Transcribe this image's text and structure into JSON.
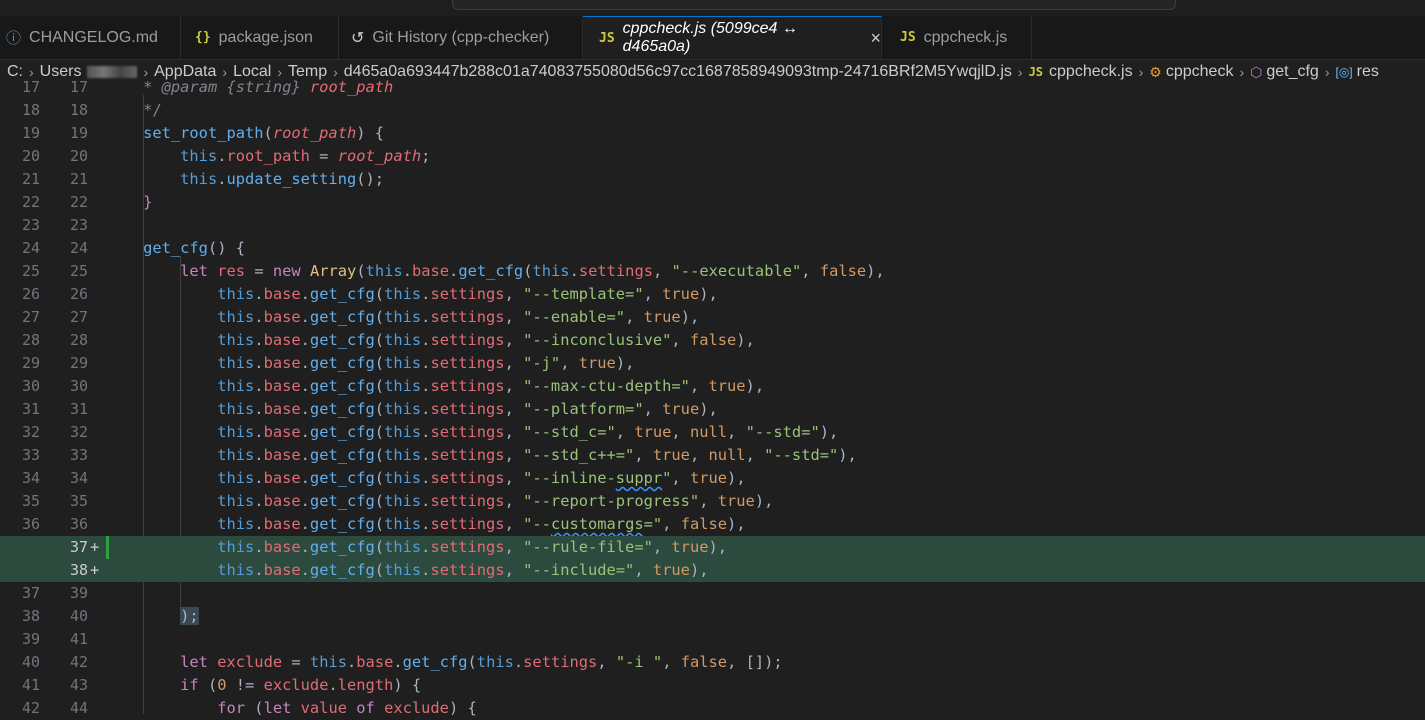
{
  "window": {
    "title_fragment": "cpp-checker"
  },
  "tabs": [
    {
      "label": "CHANGELOG.md",
      "icon": "info-circle-icon",
      "active": false
    },
    {
      "label": "package.json",
      "icon": "json-braces-icon",
      "active": false
    },
    {
      "label": "Git History (cpp-checker)",
      "icon": "history-icon",
      "active": false
    },
    {
      "label": "cppcheck.js (5099ce4 ↔ d465a0a)",
      "icon": "js-file-icon",
      "active": true,
      "close": "×"
    },
    {
      "label": "cppcheck.js",
      "icon": "js-file-icon",
      "active": false
    }
  ],
  "breadcrumb": {
    "drive": "C:",
    "users": "Users",
    "appdata": "AppData",
    "local": "Local",
    "temp": "Temp",
    "file": "d465a0a693447b288c01a74083755080d56c97cc1687858949093tmp-24716BRf2M5YwqjlD.js",
    "js_label": "JS",
    "js_file": "cppcheck.js",
    "class": "cppcheck",
    "method": "get_cfg",
    "variable": "res"
  },
  "colors": {
    "accent": "#0078d4",
    "added_line_bg": "#2d4a3e",
    "added_bar": "#2ea043",
    "js_icon": "#cbcb41"
  },
  "lines": [
    {
      "ln1": "17",
      "ln2": "17"
    },
    {
      "ln1": "18",
      "ln2": "18"
    },
    {
      "ln1": "19",
      "ln2": "19"
    },
    {
      "ln1": "20",
      "ln2": "20"
    },
    {
      "ln1": "21",
      "ln2": "21"
    },
    {
      "ln1": "22",
      "ln2": "22"
    },
    {
      "ln1": "23",
      "ln2": "23"
    },
    {
      "ln1": "24",
      "ln2": "24"
    },
    {
      "ln1": "25",
      "ln2": "25"
    },
    {
      "ln1": "26",
      "ln2": "26"
    },
    {
      "ln1": "27",
      "ln2": "27"
    },
    {
      "ln1": "28",
      "ln2": "28"
    },
    {
      "ln1": "29",
      "ln2": "29"
    },
    {
      "ln1": "30",
      "ln2": "30"
    },
    {
      "ln1": "31",
      "ln2": "31"
    },
    {
      "ln1": "32",
      "ln2": "32"
    },
    {
      "ln1": "33",
      "ln2": "33"
    },
    {
      "ln1": "34",
      "ln2": "34"
    },
    {
      "ln1": "35",
      "ln2": "35"
    },
    {
      "ln1": "36",
      "ln2": "36"
    },
    {
      "ln1": "",
      "ln2": "37",
      "plus": "+"
    },
    {
      "ln1": "",
      "ln2": "38",
      "plus": "+"
    },
    {
      "ln1": "37",
      "ln2": "39"
    },
    {
      "ln1": "38",
      "ln2": "40"
    },
    {
      "ln1": "39",
      "ln2": "41"
    },
    {
      "ln1": "40",
      "ln2": "42"
    },
    {
      "ln1": "41",
      "ln2": "43"
    },
    {
      "ln1": "42",
      "ln2": "44"
    }
  ],
  "code": {
    "l17a": "* ",
    "l17b": "@param",
    "l17c": " {string} ",
    "l17d": "root_path",
    "l18": "*/",
    "l19a": "set_root_path",
    "l19b": "(",
    "l19c": "root_path",
    "l19d": ") {",
    "l20a": "this",
    "l20b": ".",
    "l20c": "root_path",
    "l20d": " = ",
    "l20e": "root_path",
    "l20f": ";",
    "l21a": "this",
    "l21b": ".",
    "l21c": "update_setting",
    "l21d": "();",
    "l22": "}",
    "l24a": "get_cfg",
    "l24b": "() {",
    "l25a": "let",
    "l25b": "res",
    "l25c": "=",
    "l25d": "new",
    "l25e": "Array",
    "l25f": "(",
    "this": "this",
    "base": "base",
    "get_cfg": "get_cfg",
    "settings": "settings",
    "dot": ".",
    "open": "(",
    "comma": ", ",
    "close_comma": "),",
    "s_exec": "\"--executable\"",
    "s_tmpl": "\"--template=\"",
    "s_enable": "\"--enable=\"",
    "s_incon": "\"--inconclusive\"",
    "s_j": "\"-j\"",
    "s_ctu": "\"--max-ctu-depth=\"",
    "s_plat": "\"--platform=\"",
    "s_stdc": "\"--std_c=\"",
    "s_stdcpp": "\"--std_c++=\"",
    "s_std": "\"--std=\"",
    "s_inl1": "\"--inline-",
    "s_inl2": "suppr",
    "s_inl3": "\"",
    "s_rep": "\"--report-progress\"",
    "s_cus1": "\"--",
    "s_cus2": "customargs",
    "s_cus3": "=\"",
    "s_rule": "\"--rule-file=\"",
    "s_incl": "\"--include=\"",
    "true": "true",
    "false": "false",
    "null": "null",
    "l40": ");",
    "l42a": "let",
    "l42b": "exclude",
    "l42c": " = ",
    "s_i": "\"-i \"",
    "l42d": ", [])",
    "l42e": ";",
    "l43a": "if",
    "l43b": " (",
    "l43c": "0",
    "l43d": " != ",
    "l43e": "exclude",
    "l43f": ".",
    "l43g": "length",
    "l43h": ") {",
    "l44a": "for",
    "l44b": " (",
    "l44c": "let",
    "l44d": " value ",
    "l44e": "of",
    "l44f": " exclude",
    "l44g": ") {"
  }
}
